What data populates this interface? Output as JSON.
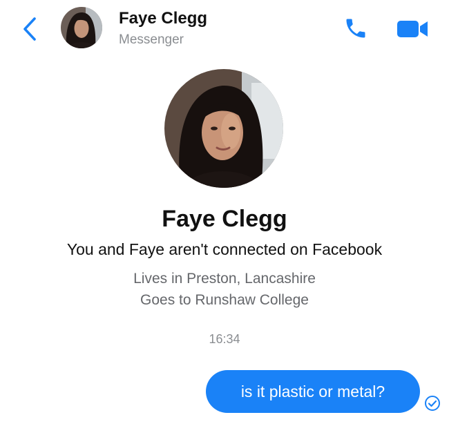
{
  "header": {
    "name": "Faye Clegg",
    "subtitle": "Messenger",
    "back_icon": "chevron-left-icon",
    "call_icon": "phone-icon",
    "video_icon": "video-camera-icon"
  },
  "profile": {
    "name": "Faye Clegg",
    "connection_note": "You and Faye aren't connected on Facebook",
    "details": [
      "Lives in Preston, Lancashire",
      "Goes to Runshaw College"
    ]
  },
  "conversation": {
    "timestamp": "16:34",
    "messages": [
      {
        "text": "is it plastic or metal?",
        "direction": "outgoing",
        "status_icon": "delivered-check-icon"
      }
    ]
  },
  "colors": {
    "accent": "#1a82f7",
    "muted_text": "#8a8d91",
    "detail_text": "#65676b"
  }
}
